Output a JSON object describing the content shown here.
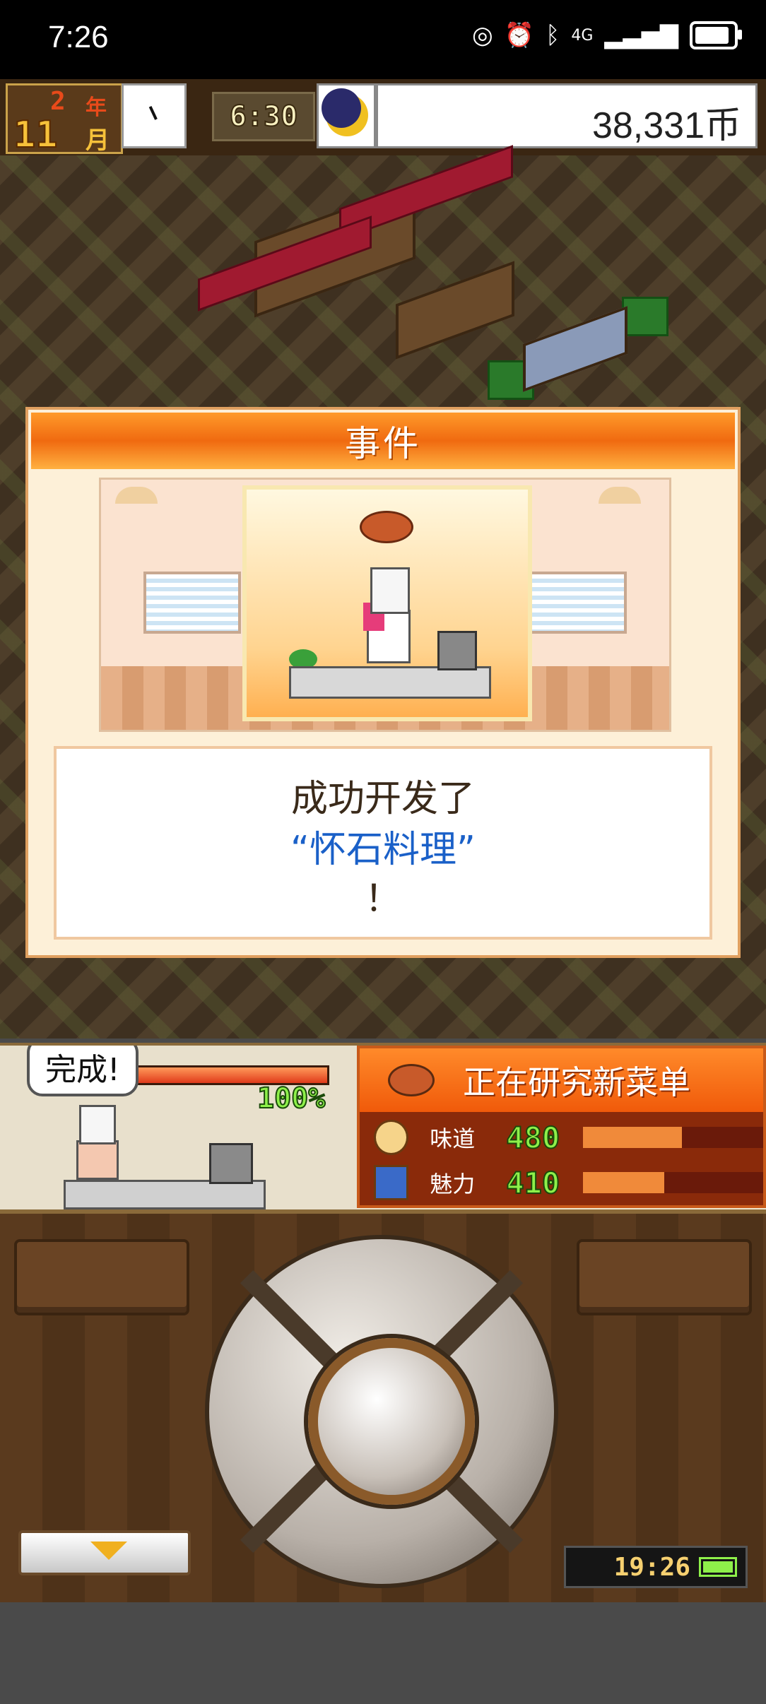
{
  "status_bar": {
    "time": "7:26",
    "network": "4G",
    "icons": [
      "data-saver-icon",
      "alarm-icon",
      "bluetooth-icon",
      "signal-icon",
      "battery-icon"
    ]
  },
  "top_bar": {
    "year_num": "2",
    "year_unit": "年",
    "month_num": "11",
    "month_unit": "月",
    "game_time": "6:30",
    "money": "38,331币"
  },
  "event": {
    "title": "事件",
    "message_line1": "成功开发了",
    "message_line2": "“怀石料理”",
    "message_line3": "！"
  },
  "hud": {
    "bubble": "完成!",
    "percent": "100%",
    "progress": 1.0,
    "research_title": "正在研究新菜单",
    "stats": [
      {
        "label": "味道",
        "value": "480",
        "level": 0.55
      },
      {
        "label": "魅力",
        "value": "410",
        "level": 0.45
      }
    ]
  },
  "controller": {
    "clock": "19:26"
  },
  "colors": {
    "accent": "#f06a10",
    "money_text": "#222222",
    "highlight_blue": "#1a60c8",
    "stat_green": "#8ef04a"
  }
}
